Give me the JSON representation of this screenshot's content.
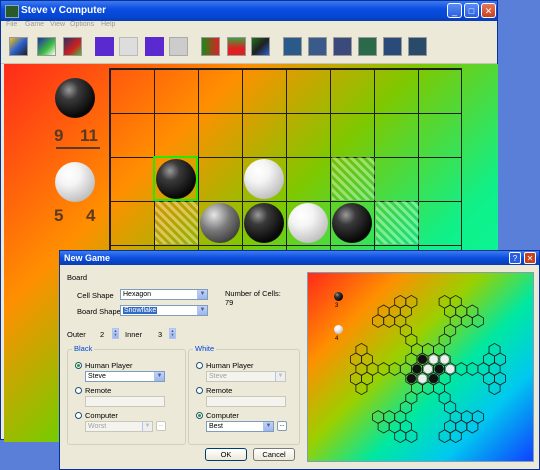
{
  "window": {
    "title": "Steve v Computer"
  },
  "menu": [
    "File",
    "Game",
    "View",
    "Options",
    "Help"
  ],
  "toolbar": {
    "buttons": [
      "new-game",
      "open",
      "save",
      "undo",
      "redo",
      "undo-all",
      "hint",
      "stats-chart",
      "bar-chart",
      "board",
      "theme-1",
      "theme-2",
      "theme-3",
      "theme-4",
      "theme-5",
      "theme-6"
    ]
  },
  "scores": {
    "black_captured": "9",
    "black_total": "11",
    "white_captured": "5",
    "white_total": "4"
  },
  "dialog": {
    "title": "New Game",
    "board_label": "Board",
    "cell_shape_label": "Cell Shape",
    "cell_shape_value": "Hexagon",
    "board_shape_label": "Board Shape",
    "board_shape_value": "Snowflake",
    "num_cells_label": "Number of Cells:",
    "num_cells_value": "79",
    "outer_label": "Outer",
    "outer_value": "2",
    "inner_label": "Inner",
    "inner_value": "3",
    "black": {
      "title": "Black",
      "human_label": "Human Player",
      "human_value": "Steve",
      "remote_label": "Remote",
      "computer_label": "Computer",
      "computer_value": "Worst"
    },
    "white": {
      "title": "White",
      "human_label": "Human Player",
      "human_value": "Steve",
      "remote_label": "Remote",
      "computer_label": "Computer",
      "computer_value": "Best"
    },
    "ok_label": "OK",
    "cancel_label": "Cancel",
    "dots_label": "...",
    "preview": {
      "black_count": "3",
      "white_count": "4"
    }
  },
  "colors": {
    "xp_blue": "#0a4ee0",
    "selection": "#316ac5"
  }
}
